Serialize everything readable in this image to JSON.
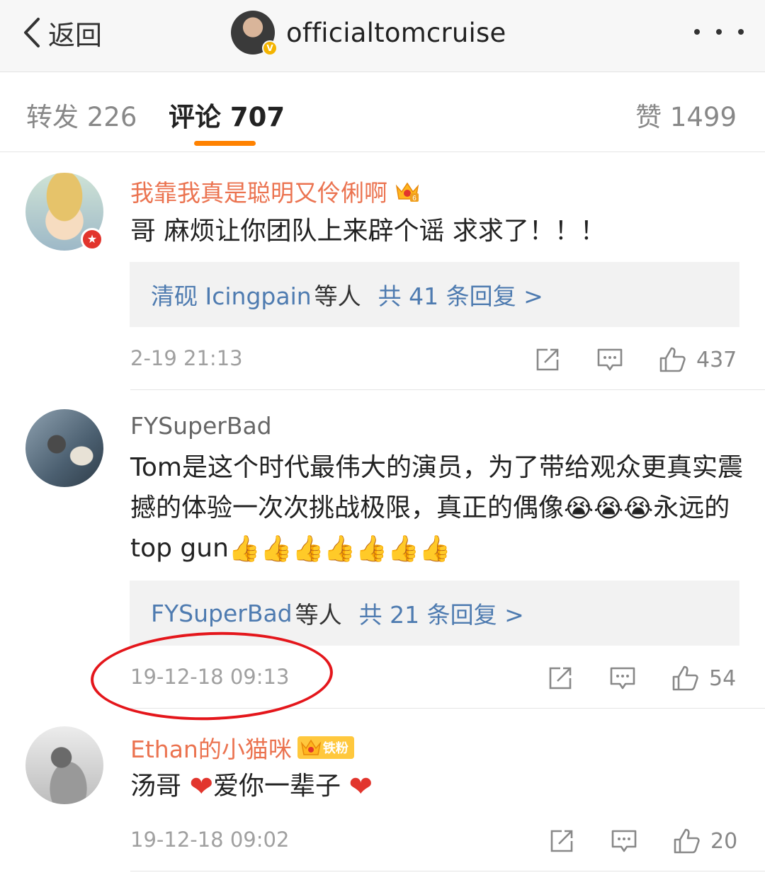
{
  "nav": {
    "back_label": "返回",
    "account_name": "officialtomcruise",
    "verified_badge": "V"
  },
  "tabs": {
    "reposts": "转发 226",
    "comments": "评论 707",
    "likes": "赞 1499"
  },
  "comments": [
    {
      "username": "我靠我真是聪明又伶俐啊",
      "badge_level": "6",
      "text": "哥 麻烦让你团队上来辟个谣 求求了！！！",
      "replies": {
        "who": "清砚 Icingpain",
        "etc": "等人",
        "count": "共 41 条回复 >"
      },
      "time": "2-19 21:13",
      "likes": "437"
    },
    {
      "username": "FYSuperBad",
      "text_part1": "Tom是这个时代最伟大的演员，为了带给观众更真实震撼的体验一次次挑战极限，真正的偶像",
      "text_part2": "永远的 top gun",
      "emoji_crying": "😭",
      "emoji_thumbs": "👍",
      "replies": {
        "who": "FYSuperBad",
        "etc": "等人",
        "count": "共 21 条回复 >"
      },
      "time": "19-12-18 09:13",
      "likes": "54"
    },
    {
      "username": "Ethan的小猫咪",
      "fan_badge": "铁粉",
      "text_part1": "汤哥",
      "text_part2": "爱你一辈子",
      "heart": "❤",
      "time": "19-12-18 09:02",
      "likes": "20"
    }
  ],
  "colors": {
    "accent": "#ff8200",
    "username_orange": "#eb7350",
    "link_blue": "#4e7bb0",
    "highlight_circle": "#e4161b"
  }
}
